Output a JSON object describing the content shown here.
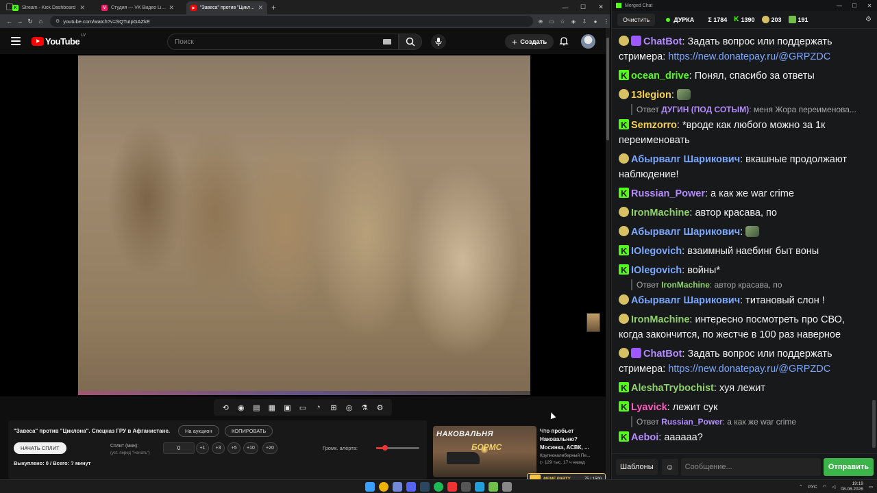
{
  "browser": {
    "tabs": [
      {
        "label": "Stream - Kick Dashboard",
        "favicon_color": "#53fc18",
        "favicon_glyph": "K"
      },
      {
        "label": "Студия — VK Видео Live",
        "favicon_color": "#e91e63",
        "favicon_glyph": "V"
      },
      {
        "label": "\"Завеса\" против \"Циклона",
        "favicon_color": "#ff0000",
        "favicon_glyph": "▶"
      }
    ],
    "url": "youtube.com/watch?v=SQTuIpGAZkE"
  },
  "youtube": {
    "logo_text": "YouTube",
    "country_code": "LV",
    "search_placeholder": "Поиск",
    "create_label": "Создать"
  },
  "panel": {
    "title": "\"Завеса\" против \"Циклона\". Спецназ ГРУ в Афганистане.",
    "auction_label": "На аукцион",
    "copy_label": "КОПИРОВАТЬ",
    "start_split_label": "НАЧАТЬ СПЛИТ",
    "split_label": "Сплит (мин):",
    "split_hint": "(уст. перед \"Начать\")",
    "split_value": "0",
    "increments": [
      "+1",
      "+3",
      "+5",
      "+10",
      "+20"
    ],
    "volume_label": "Громк. алерта:",
    "volume_level": 0.2,
    "bought_text": "Выкуплено: 0 / Всего: ? минут"
  },
  "recommendation": {
    "thumb_line1": "НАКОВАЛЬНЯ",
    "thumb_line2": "БОРМС",
    "title": "Что пробьет Наковальню? Мосинка, АСВК, ...",
    "channel": "Крупнокалиберный Пе...",
    "meta": "129 тыс.  17 ч назад"
  },
  "overlay_badge": {
    "name": "MEME PARTY",
    "count": "75 / 1500"
  },
  "chat": {
    "window_title": "Merged Chat",
    "clear_label": "Очистить",
    "channel_name": "ДУРКА",
    "stats": {
      "total": "Σ 1784",
      "kick": "1390",
      "youtube": "203",
      "vk": "191"
    },
    "messages": [
      {
        "platform": "yt-bot",
        "user": "ChatBot",
        "color": "#b48cff",
        "text": " Задать вопрос или поддержать стримера: ",
        "link": "https://new.donatepay.ru/@GRPZDC"
      },
      {
        "platform": "kick",
        "user": "ocean_drive",
        "color": "#53fc18",
        "text": " Понял, спасибо за ответы"
      },
      {
        "platform": "yt",
        "user": "13legion",
        "color": "#f5d14a",
        "text": " ",
        "emote": true,
        "reply": {
          "prefix": "Ответ",
          "user": "ДУГИН (ПОД СОТЫМ)",
          "user_color": "#b48cff",
          "text": ": меня Жора переименова..."
        }
      },
      {
        "platform": "kick",
        "user": "Semzorro",
        "color": "#f5d14a",
        "text": " *вроде как любого можно за 1к переименовать"
      },
      {
        "platform": "yt",
        "user": "Абырвалг Шарикович",
        "color": "#7aa7ff",
        "text": " вкашные продолжают наблюдение!"
      },
      {
        "platform": "kick",
        "user": "Russian_Power",
        "color": "#b48cff",
        "text": " а как же war crime"
      },
      {
        "platform": "yt",
        "user": "IronMachine",
        "color": "#8fd16a",
        "text": " автор красава, по"
      },
      {
        "platform": "yt",
        "user": "Абырвалг Шарикович",
        "color": "#7aa7ff",
        "text": " ",
        "emote": true
      },
      {
        "platform": "kick",
        "user": "IOlegovich",
        "color": "#7aa7ff",
        "text": " взаимный наебинг быт воны"
      },
      {
        "platform": "kick",
        "user": "IOlegovich",
        "color": "#7aa7ff",
        "text": " войны*",
        "reply": {
          "prefix": "Ответ",
          "user": "IronMachine",
          "user_color": "#8fd16a",
          "text": ": автор красава, по"
        }
      },
      {
        "platform": "yt",
        "user": "Абырвалг Шарикович",
        "color": "#7aa7ff",
        "text": " титановый слон !"
      },
      {
        "platform": "yt",
        "user": "IronMachine",
        "color": "#8fd16a",
        "text": " интересно посмотреть про СВО, когда закончится, по жестче  в 100 раз наверное"
      },
      {
        "platform": "yt-bot",
        "user": "ChatBot",
        "color": "#b48cff",
        "text": " Задать вопрос или поддержать стримера: ",
        "link": "https://new.donatepay.ru/@GRPZDC"
      },
      {
        "platform": "kick",
        "user": "AleshaTrybochist",
        "color": "#8fd16a",
        "text": " хуя лежит"
      },
      {
        "platform": "kick",
        "user": "Lyavick",
        "color": "#ff5cbf",
        "text": " лежит сук",
        "reply": {
          "prefix": "Ответ",
          "user": "Russian_Power",
          "user_color": "#b48cff",
          "text": ": а как же war crime"
        }
      },
      {
        "platform": "kick",
        "user": "Aeboi",
        "color": "#b48cff",
        "text": " аааааа?"
      }
    ],
    "templates_label": "Шаблоны",
    "input_placeholder": "Сообщение...",
    "send_label": "Отправить"
  },
  "taskbar": {
    "lang": "РУС",
    "time": "19:19",
    "date": "08.08.2026"
  }
}
